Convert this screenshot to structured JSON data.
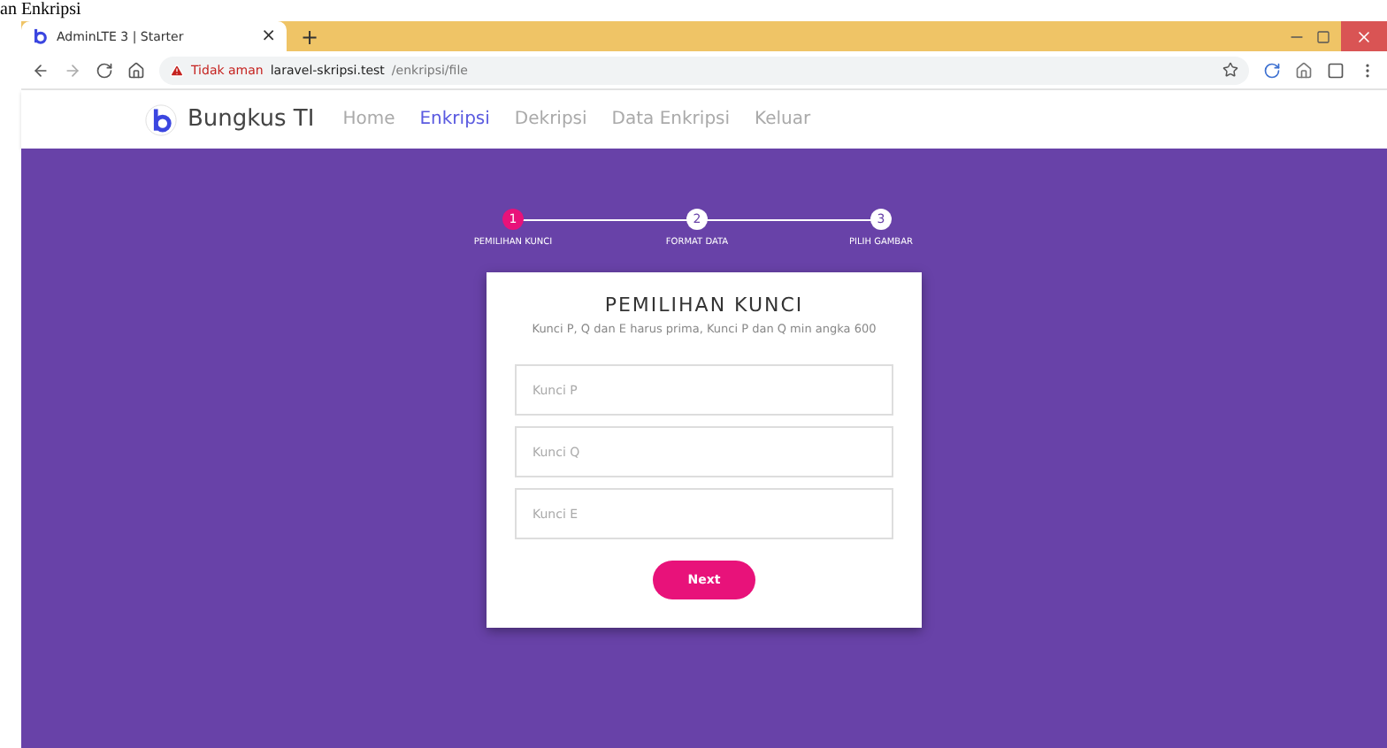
{
  "caption": "an Enkripsi",
  "browser": {
    "tab_title": "AdminLTE 3 | Starter",
    "tab_close": "×",
    "new_tab": "+",
    "security": "Tidak aman",
    "url_host": "laravel-skripsi.test",
    "url_path": "/enkripsi/file"
  },
  "navbar": {
    "brand": "Bungkus TI",
    "items": [
      {
        "label": "Home",
        "selected": false
      },
      {
        "label": "Enkripsi",
        "selected": true
      },
      {
        "label": "Dekripsi",
        "selected": false
      },
      {
        "label": "Data Enkripsi",
        "selected": false
      },
      {
        "label": "Keluar",
        "selected": false
      }
    ]
  },
  "steps": [
    {
      "number": "1",
      "label": "PEMILIHAN KUNCI",
      "selected": true
    },
    {
      "number": "2",
      "label": "FORMAT DATA",
      "selected": false
    },
    {
      "number": "3",
      "label": "PILIH GAMBAR",
      "selected": false
    }
  ],
  "card": {
    "title": "PEMILIHAN KUNCI",
    "subtitle": "Kunci P, Q dan E harus prima, Kunci P dan Q min angka 600",
    "fields": [
      {
        "placeholder": "Kunci P"
      },
      {
        "placeholder": "Kunci Q"
      },
      {
        "placeholder": "Kunci E"
      }
    ],
    "button": "Next"
  }
}
